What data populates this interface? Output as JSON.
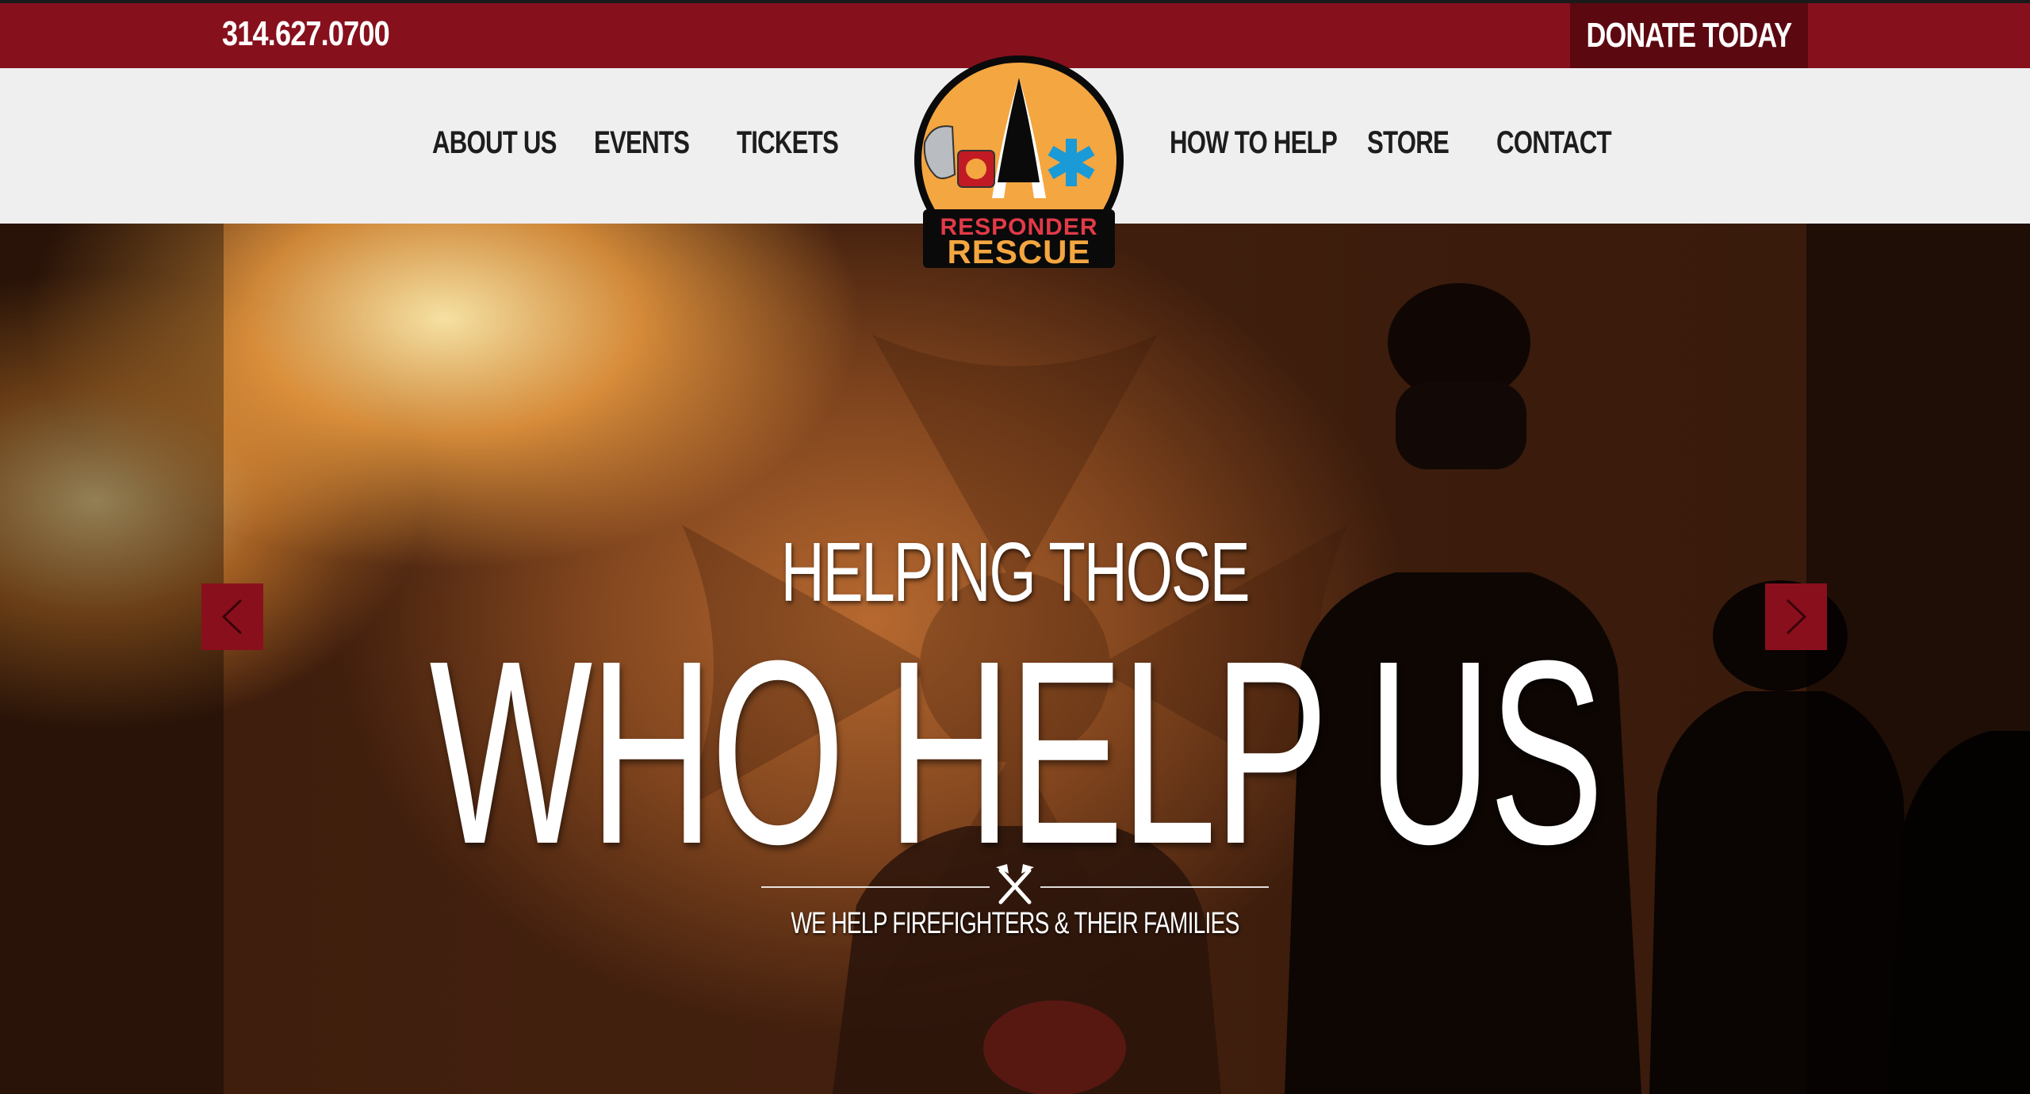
{
  "topbar": {
    "phone": "314.627.0700",
    "donate_label": "DONATE TODAY"
  },
  "nav": {
    "left": [
      "ABOUT US",
      "EVENTS",
      "TICKETS"
    ],
    "right": [
      "HOW TO HELP",
      "STORE",
      "CONTACT"
    ]
  },
  "logo": {
    "line1": "RESPONDER",
    "line2": "RESCUE"
  },
  "hero": {
    "subtitle": "HELPING THOSE",
    "title": "WHO HELP US",
    "tagline": "WE HELP FIREFIGHTERS & THEIR FAMILIES"
  },
  "slider": {
    "prev_icon": "chevron-left-icon",
    "next_icon": "chevron-right-icon"
  },
  "colors": {
    "brand_red": "#87101d",
    "donate_bg": "#5c0810",
    "nav_bg": "#efefef",
    "arrow_bg": "#8a0f1c",
    "logo_orange": "#f4a640"
  }
}
